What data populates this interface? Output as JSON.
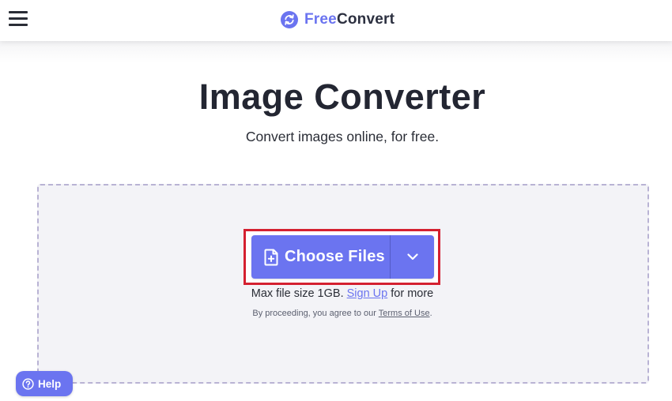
{
  "header": {
    "logo_free": "Free",
    "logo_convert": "Convert",
    "menu_icon": "hamburger-menu-icon",
    "logo_icon": "refresh-circle-icon"
  },
  "main": {
    "title": "Image Converter",
    "subtitle": "Convert images online, for free."
  },
  "upload": {
    "choose_label": "Choose Files",
    "choose_icon": "file-plus-icon",
    "dropdown_icon": "chevron-down-icon",
    "limit_prefix": "Max file size 1GB.",
    "signup_link": "Sign Up",
    "limit_suffix": "for more",
    "terms_prefix": "By proceeding, you agree to our",
    "terms_link": "Terms of Use",
    "terms_suffix": "."
  },
  "help": {
    "label": "Help",
    "icon": "question-circle-icon"
  },
  "colors": {
    "accent": "#6b74f0",
    "highlight": "#d42030",
    "dropzone_border": "#b9b3d4",
    "dropzone_bg": "#f3f3f7",
    "text": "#232632"
  }
}
